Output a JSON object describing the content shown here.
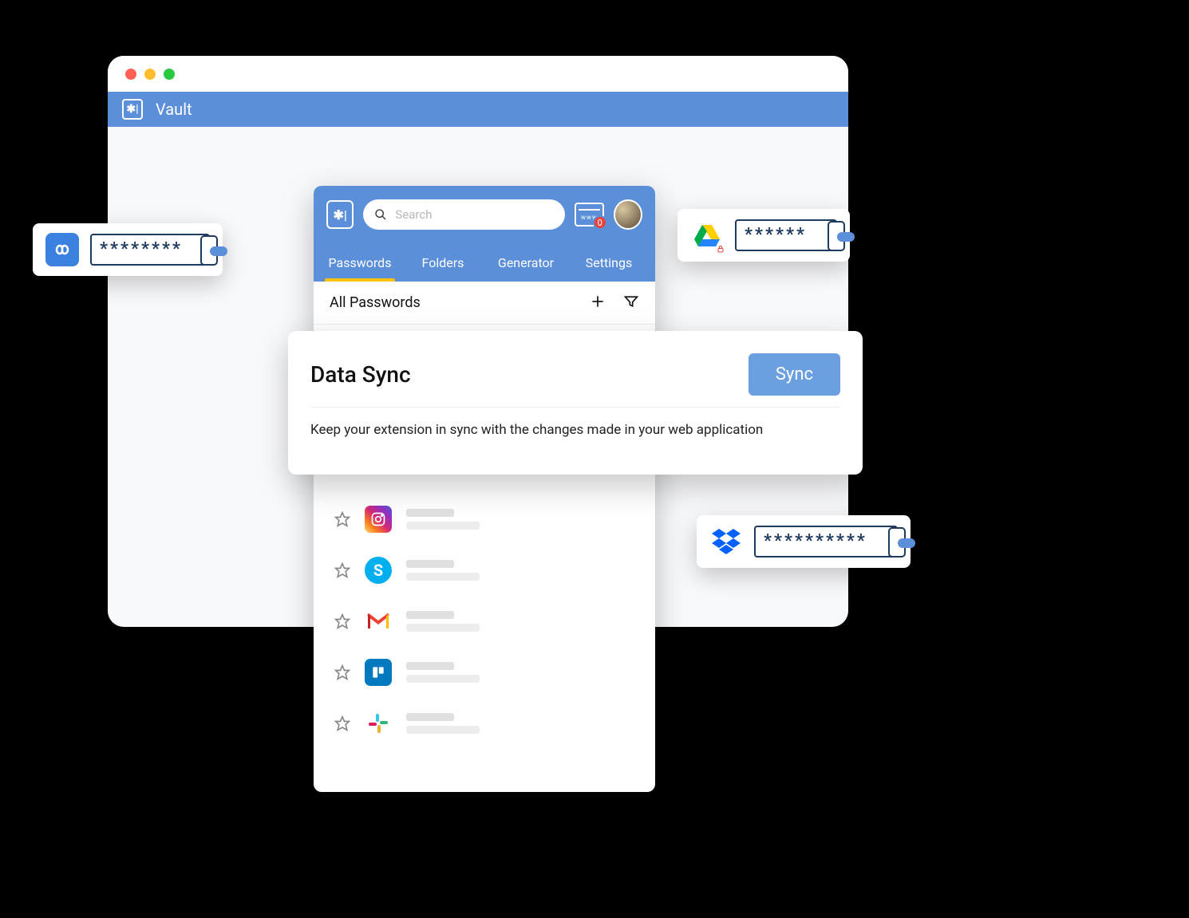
{
  "header": {
    "title": "Vault"
  },
  "extension": {
    "search_placeholder": "Search",
    "badge_count": "0",
    "tabs": [
      {
        "label": "Passwords",
        "active": true
      },
      {
        "label": "Folders",
        "active": false
      },
      {
        "label": "Generator",
        "active": false
      },
      {
        "label": "Settings",
        "active": false
      }
    ],
    "list_title": "All Passwords",
    "items": [
      {
        "icon": "instagram"
      },
      {
        "icon": "skype"
      },
      {
        "icon": "gmail"
      },
      {
        "icon": "trello"
      },
      {
        "icon": "slack"
      }
    ]
  },
  "sync": {
    "title": "Data Sync",
    "button": "Sync",
    "description": "Keep your extension in sync with the changes made in your web application"
  },
  "cards": {
    "left": {
      "stars": "********",
      "brand": "infinity"
    },
    "right": {
      "stars": "******",
      "brand": "drive"
    },
    "bottom": {
      "stars": "**********",
      "brand": "dropbox"
    }
  }
}
